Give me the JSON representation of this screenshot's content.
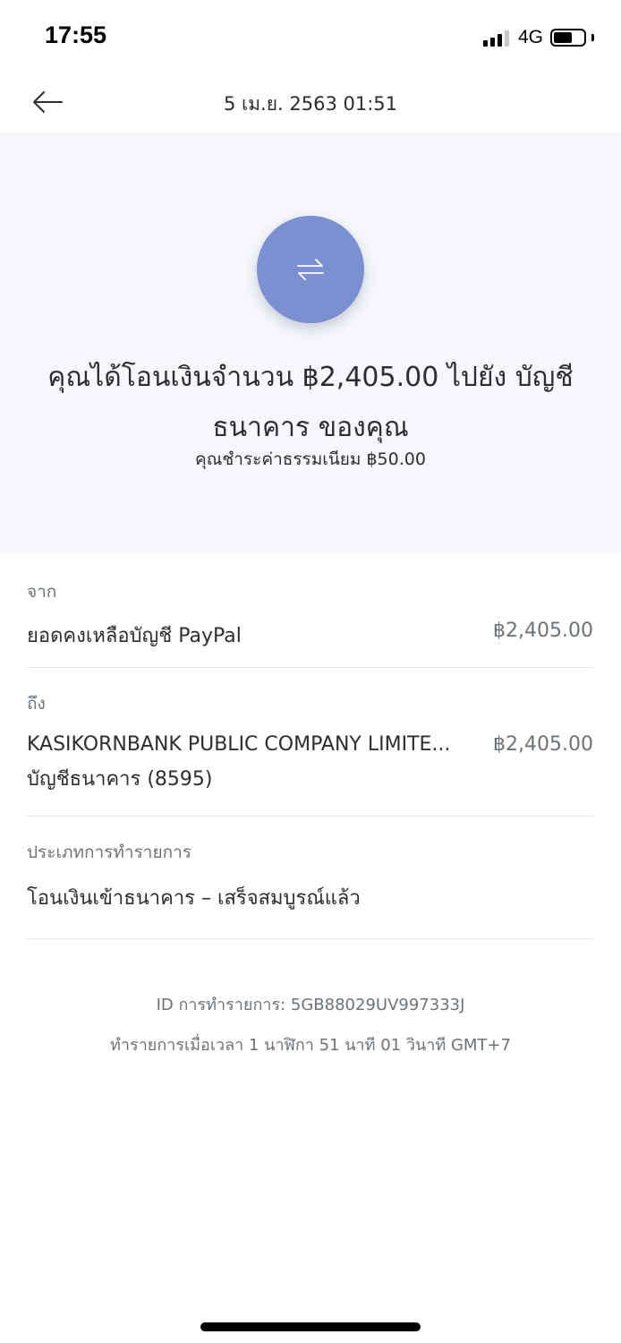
{
  "status_bar": {
    "time": "17:55",
    "network": "4G"
  },
  "header": {
    "title": "5 เม.ย. 2563  01:51"
  },
  "hero": {
    "icon": "transfer-arrows-icon",
    "icon_color": "#7b8fd1",
    "title": "คุณได้โอนเงินจำนวน ฿2,405.00 ไปยัง บัญชีธนาคาร ของคุณ",
    "fee": "คุณชำระค่าธรรมเนียม ฿50.00"
  },
  "from": {
    "label": "จาก",
    "account": "ยอดคงเหลือบัญชี PayPal",
    "amount": "฿2,405.00"
  },
  "to": {
    "label": "ถึง",
    "bank": "KASIKORNBANK PUBLIC COMPANY LIMITE...",
    "account": "บัญชีธนาคาร (8595)",
    "amount": "฿2,405.00"
  },
  "transaction_type": {
    "label": "ประเภทการทำรายการ",
    "value": "โอนเงินเข้าธนาคาร – เสร็จสมบูรณ์แล้ว"
  },
  "footer": {
    "transaction_id": "ID การทำรายการ: 5GB88029UV997333J",
    "timestamp": "ทำรายการเมื่อเวลา 1 นาฬิกา 51 นาที 01 วินาที GMT+7"
  }
}
